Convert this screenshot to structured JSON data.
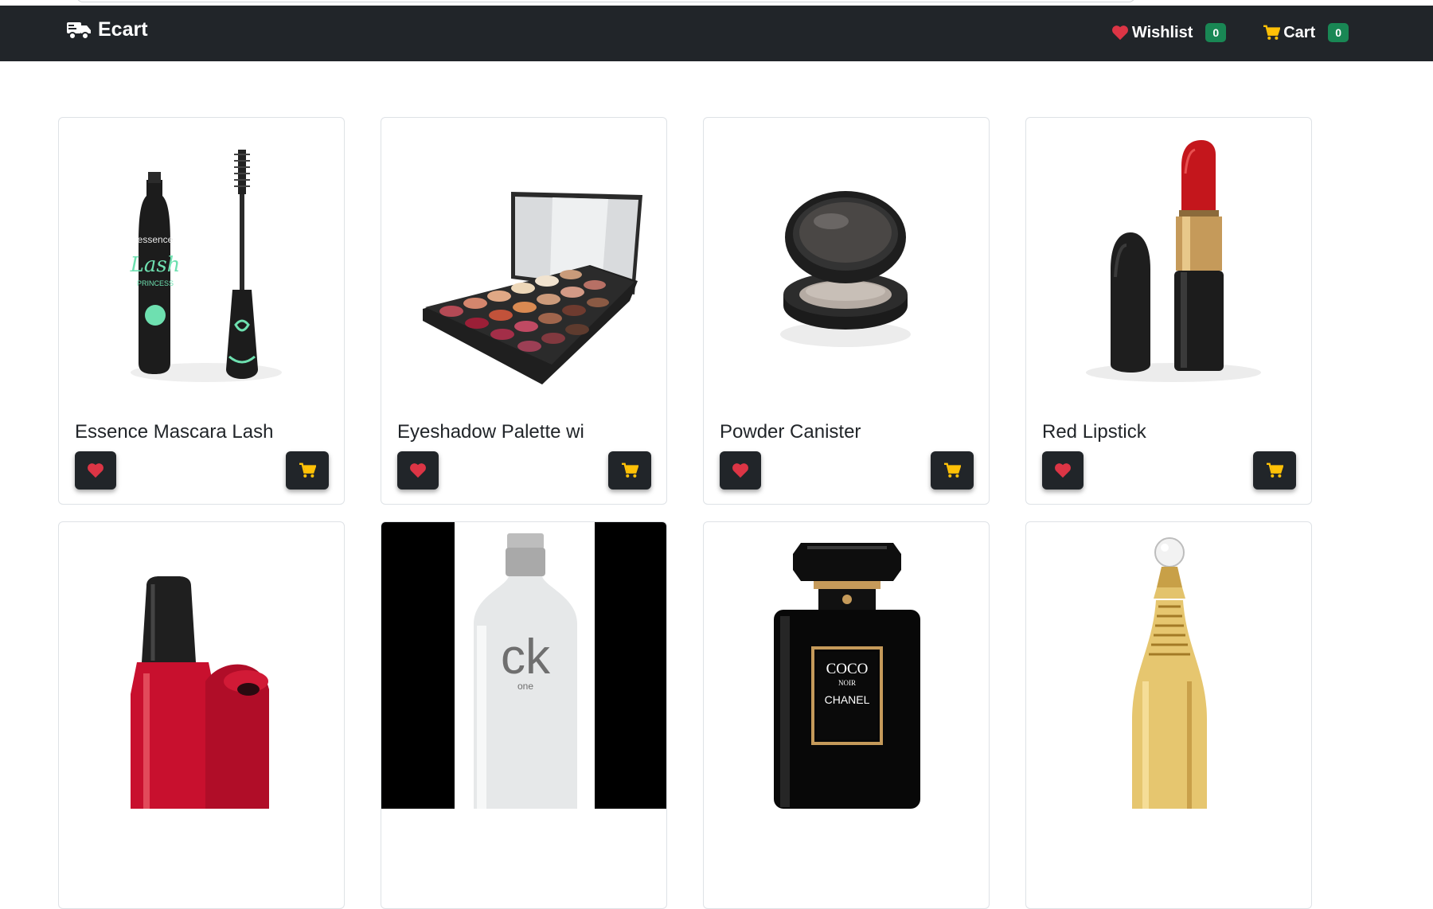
{
  "navbar": {
    "brand": "Ecart",
    "brand_icon": "truck-icon",
    "wishlist_label": "Wishlist",
    "wishlist_count": "0",
    "cart_label": "Cart",
    "cart_count": "0",
    "colors": {
      "bg": "#212529",
      "heart": "#dc3545",
      "cart": "#ffc107",
      "badge": "#198754"
    }
  },
  "products": [
    {
      "title": "Essence Mascara Lash",
      "image": "mascara"
    },
    {
      "title": "Eyeshadow Palette wi",
      "image": "eyeshadow-palette"
    },
    {
      "title": "Powder Canister",
      "image": "powder-canister"
    },
    {
      "title": "Red Lipstick",
      "image": "red-lipstick"
    },
    {
      "title": "",
      "image": "red-nail-polish"
    },
    {
      "title": "",
      "image": "ck-one-perfume"
    },
    {
      "title": "",
      "image": "coco-noir-perfume"
    },
    {
      "title": "",
      "image": "jadore-perfume"
    }
  ],
  "image_text": {
    "mascara_brand": "essence",
    "mascara_name": "Lash",
    "mascara_sub": "PRINCESS",
    "ck_logo": "ck",
    "ck_sub": "one",
    "coco_line1": "COCO",
    "coco_line2": "NOIR",
    "coco_line3": "CHANEL"
  }
}
